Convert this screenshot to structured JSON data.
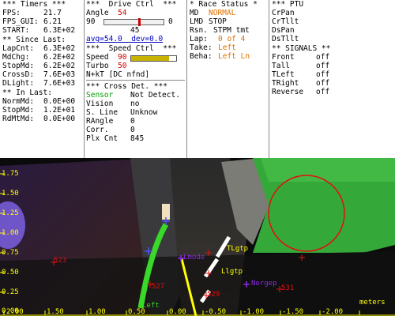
{
  "timers": {
    "header": "*** Timers ***",
    "rows": [
      {
        "label": "FPS:",
        "value": "21.7"
      },
      {
        "label": "FPS_GUI:",
        "value": "6.21"
      },
      {
        "label": "START:",
        "value": "6.3E+02"
      }
    ],
    "since_last_header": "** Since Last:",
    "since_rows": [
      {
        "label": "LapCnt:",
        "value": "6.3E+02"
      },
      {
        "label": "MdChg:",
        "value": "6.2E+02"
      },
      {
        "label": "StopMd:",
        "value": "6.2E+02"
      },
      {
        "label": "CrossD:",
        "value": "7.6E+03"
      },
      {
        "label": "DLight:",
        "value": "7.6E+03"
      }
    ],
    "in_last_header": "** In Last:",
    "in_rows": [
      {
        "label": "NormMd:",
        "value": "0.0E+00"
      },
      {
        "label": "StopMd:",
        "value": "1.2E+01"
      },
      {
        "label": "RdMtMd:",
        "value": "0.0E+00"
      }
    ]
  },
  "drive": {
    "header": "***  Drive Ctrl  ***",
    "angle_label": "Angle",
    "angle_value": "54",
    "angle_min": "90",
    "angle_max": "0",
    "angle_mid": "45",
    "angle_level": 0.6,
    "avg_dev": "avg=54.0  dev=0.0",
    "speed_header": "***  Speed Ctrl  ***",
    "speed_label": "Speed",
    "speed_value": "90",
    "speed_level": 0.85,
    "turbo_label": "Turbo",
    "turbo_value": "50",
    "nkt": "N+kT [DC nfnd]",
    "cross_header": "*** Cross Det. ***",
    "cross_rows": [
      {
        "label": "Sensor",
        "value": "Not Detect."
      },
      {
        "label": "Vision",
        "value": "no"
      },
      {
        "label": "S. Line",
        "value": "Unknow"
      },
      {
        "label": "RAngle",
        "value": "0"
      },
      {
        "label": "Corr.",
        "value": "0"
      },
      {
        "label": "Plx Cnt",
        "value": "845"
      }
    ]
  },
  "race": {
    "header": "* Race Status *",
    "rows": [
      {
        "label": "MD",
        "value": "NORMAL"
      },
      {
        "label": "LMD",
        "value": "STOP"
      },
      {
        "label": "Rsn.",
        "value": "STPM tmt"
      },
      {
        "label": "Lap:",
        "value": "0 of 4"
      },
      {
        "label": "Take:",
        "value": "Left"
      },
      {
        "label": "Beha:",
        "value": "Left Ln"
      }
    ]
  },
  "ptu": {
    "header": "*** PTU",
    "items": [
      "CrPan",
      "CrTllt",
      "DsPan",
      "DsTllt"
    ],
    "signals_header": "** SIGNALS **",
    "signals": [
      {
        "label": "Front",
        "value": "off"
      },
      {
        "label": "Tall",
        "value": "off"
      },
      {
        "label": "TLeft",
        "value": "off"
      },
      {
        "label": "TRight",
        "value": "off"
      },
      {
        "label": "Reverse",
        "value": "off"
      }
    ]
  },
  "overlay": {
    "y_ticks": [
      "1.75",
      "1.50",
      "1.25",
      "1.00",
      "0.75",
      "0.50",
      "0.25",
      "0.00"
    ],
    "x_ticks": [
      "2.00",
      "1.50",
      "1.00",
      "0.50",
      "0.00",
      "-0.50",
      "-1.00",
      "-1.50",
      "-2.00"
    ],
    "unit": "meters",
    "labels": {
      "p523": "523",
      "p527": "527",
      "p529": "529",
      "p531": "531",
      "left": "Left",
      "lmode": "Lmode",
      "tlgtp": "TLgtp",
      "llgtp": "Llgtp",
      "norgep": "Norgep"
    }
  },
  "colors": {
    "lane_green": "#39d829",
    "marker_red": "#e01010",
    "axis_yellow": "#ffff00",
    "mark_purple": "#8a2be2"
  }
}
